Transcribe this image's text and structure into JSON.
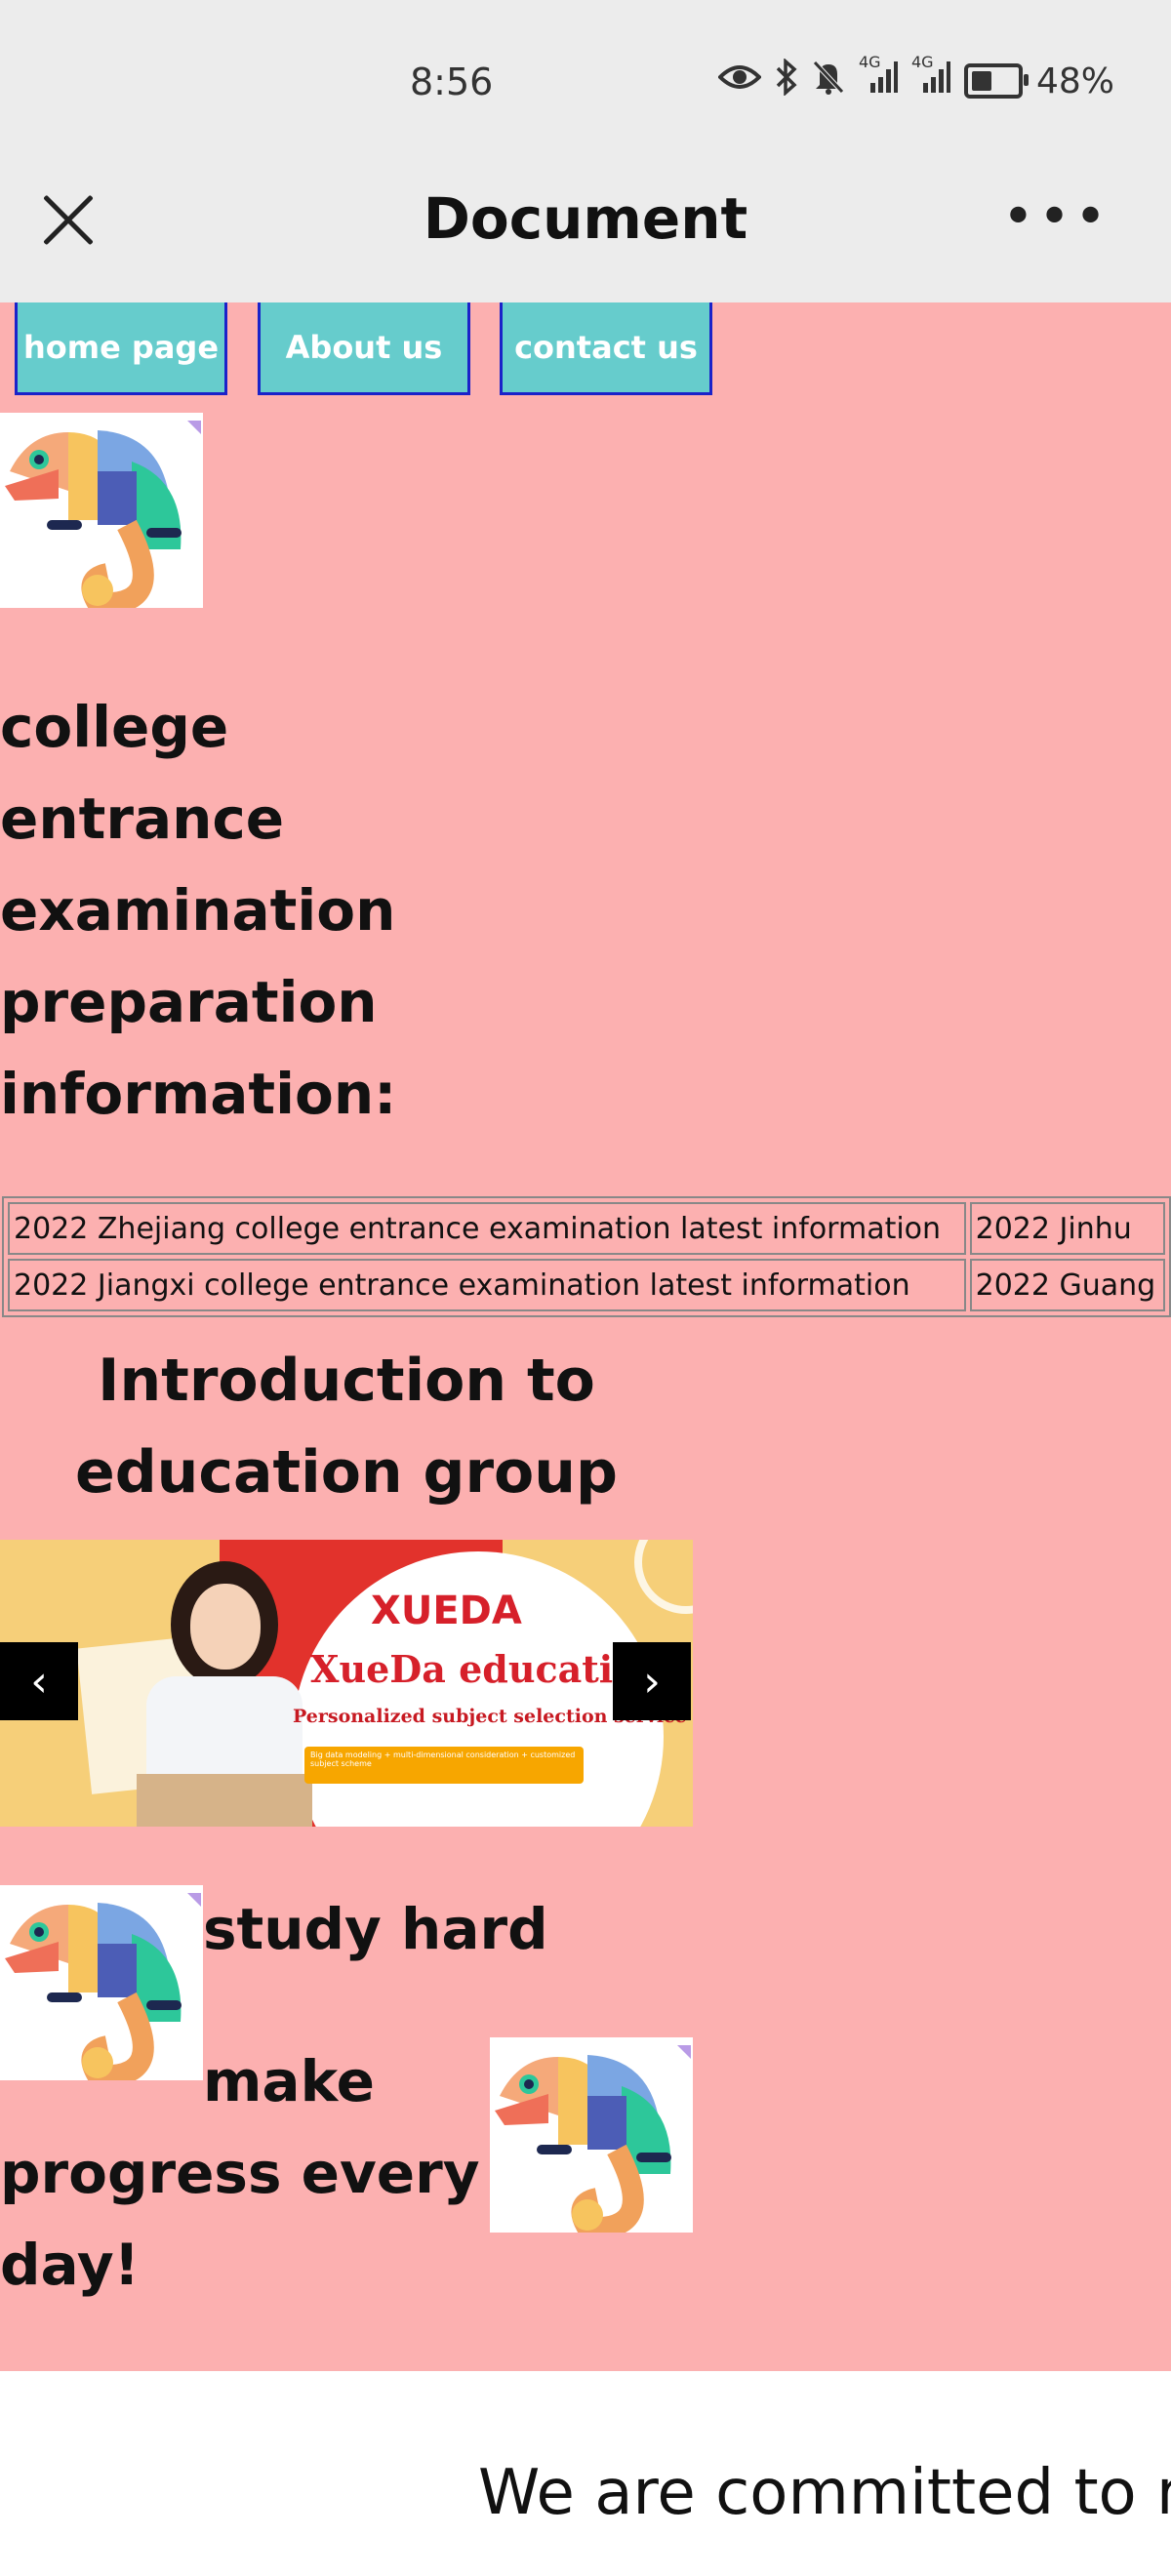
{
  "status_bar": {
    "time": "8:56",
    "network_1": "4G",
    "network_2": "4G",
    "battery": "48%",
    "icons": [
      "eye-icon",
      "bluetooth-icon",
      "bell-off-icon",
      "signal-icon",
      "signal-icon",
      "battery-icon"
    ]
  },
  "title_bar": {
    "title": "Document",
    "close_icon": "close-icon",
    "more_icon": "more-icon"
  },
  "nav": {
    "items": [
      {
        "label": "home page"
      },
      {
        "label": "About us"
      },
      {
        "label": "contact us"
      }
    ]
  },
  "main": {
    "heading": "college entrance examination preparation information:",
    "table": [
      [
        "2022 Zhejiang college entrance examination latest information",
        "2022 Jinhu"
      ],
      [
        "2022 Jiangxi college entrance examination latest information",
        "2022 Guang"
      ]
    ],
    "intro_title": "Introduction to education group",
    "banner": {
      "logo": "XUEDA",
      "name": "XueDa  education",
      "tagline": "Personalized subject selection service",
      "bar_text": "Big data modeling + multi-dimensional consideration + customized subject scheme",
      "prev": "‹",
      "next": "›"
    },
    "motto_line1": "study hard",
    "motto_line2": "make",
    "motto_line3": "progress every",
    "motto_line4": "day!"
  },
  "footer": {
    "text": "We are committed to m"
  },
  "colors": {
    "page_bg": "#fcb0b0",
    "nav_bg": "#66cccc",
    "nav_border": "#1a22c9"
  }
}
